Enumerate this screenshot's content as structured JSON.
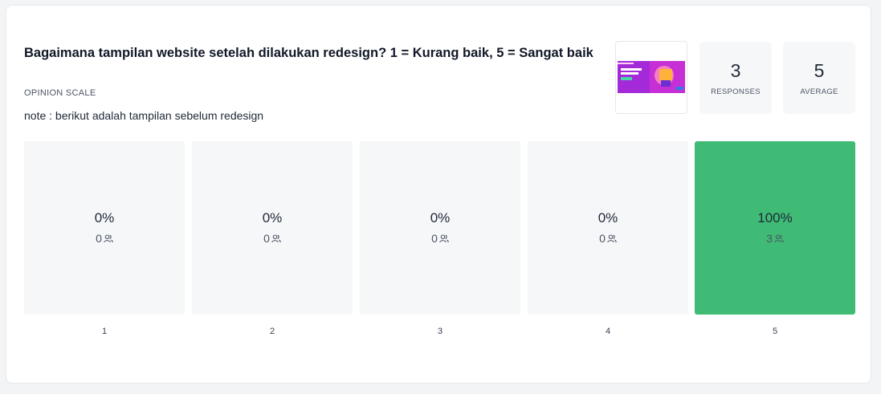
{
  "question": {
    "title": "Bagaimana tampilan website setelah dilakukan redesign? 1 = Kurang baik, 5 = Sangat baik",
    "type_label": "OPINION SCALE",
    "note": "note : berikut adalah tampilan sebelum redesign"
  },
  "stats": {
    "responses_value": "3",
    "responses_label": "RESPONSES",
    "average_value": "5",
    "average_label": "AVERAGE"
  },
  "colors": {
    "accent_green": "#3fbb76",
    "bar_bg": "#f6f7f9"
  },
  "thumbnail": {
    "icon": "website-screenshot-image"
  },
  "options": [
    {
      "label": "1",
      "percent": "0%",
      "count": "0",
      "active": false
    },
    {
      "label": "2",
      "percent": "0%",
      "count": "0",
      "active": false
    },
    {
      "label": "3",
      "percent": "0%",
      "count": "0",
      "active": false
    },
    {
      "label": "4",
      "percent": "0%",
      "count": "0",
      "active": false
    },
    {
      "label": "5",
      "percent": "100%",
      "count": "3",
      "active": true
    }
  ]
}
